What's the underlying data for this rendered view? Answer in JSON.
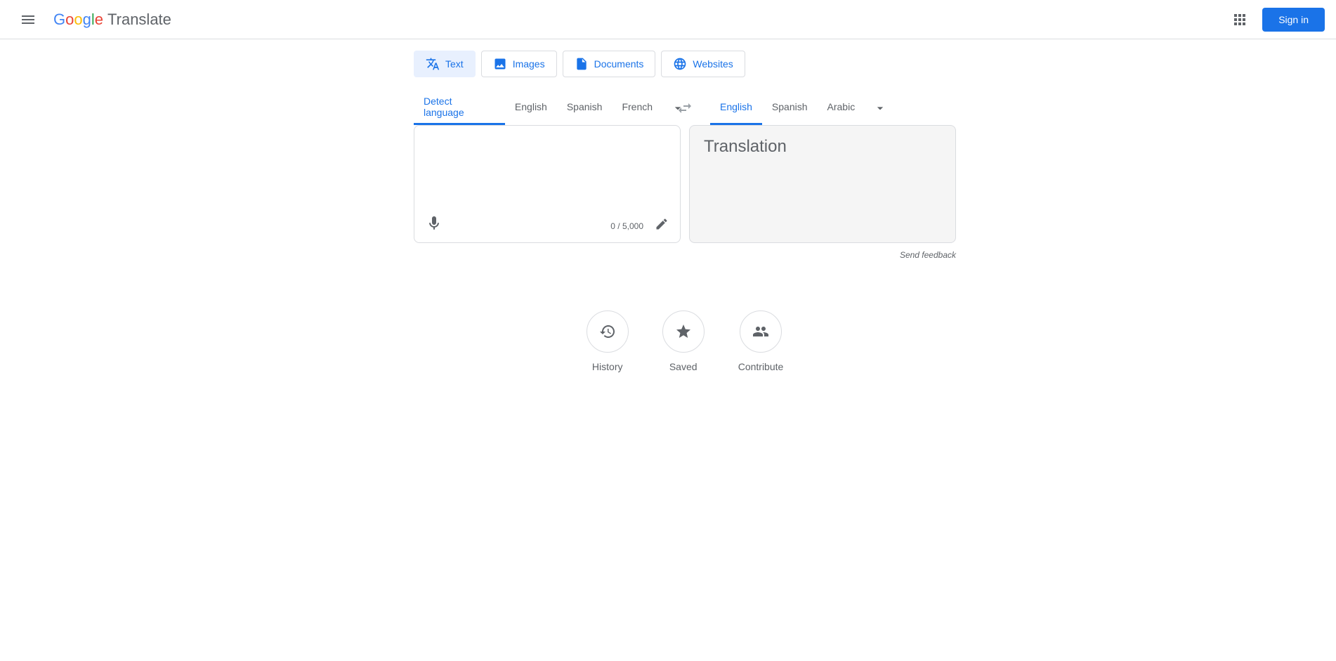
{
  "header": {
    "title": "Translate",
    "signin": "Sign in"
  },
  "modes": {
    "text": "Text",
    "images": "Images",
    "documents": "Documents",
    "websites": "Websites"
  },
  "source": {
    "detect": "Detect language",
    "english": "English",
    "spanish": "Spanish",
    "french": "French",
    "char_count": "0 / 5,000"
  },
  "target": {
    "english": "English",
    "spanish": "Spanish",
    "arabic": "Arabic",
    "placeholder": "Translation"
  },
  "feedback": "Send feedback",
  "actions": {
    "history": "History",
    "saved": "Saved",
    "contribute": "Contribute"
  }
}
